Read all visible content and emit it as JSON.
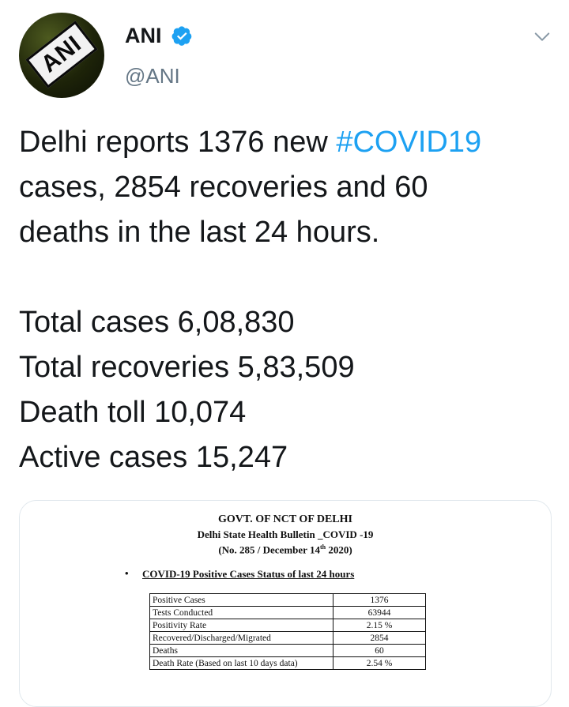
{
  "author": {
    "name": "ANI",
    "handle": "@ANI",
    "avatar_text": "ANI",
    "verified": true,
    "verified_icon": "verified-badge-icon",
    "verified_color": "#1da1f2"
  },
  "menu_icon": "chevron-down-icon",
  "tweet": {
    "line1_pre": "Delhi reports 1376 new ",
    "hashtag": "#COVID19",
    "line_rest": "cases, 2854 recoveries and 60\ndeaths in the last 24 hours.\n\nTotal cases 6,08,830\nTotal recoveries 5,83,509\nDeath toll 10,074\nActive cases 15,247"
  },
  "colors": {
    "link": "#1da1f2",
    "text": "#14171a",
    "secondary": "#657786"
  },
  "document": {
    "title1": "GOVT. OF NCT OF DELHI",
    "title2": "Delhi State Health Bulletin _COVID -19",
    "title3_pre": "(No. 285 / December 14",
    "title3_sup": "th",
    "title3_post": " 2020)",
    "bullet": "•",
    "subheading": "COVID-19 Positive Cases Status of last 24 hours",
    "table": [
      {
        "label": "Positive Cases",
        "value": "1376"
      },
      {
        "label": "Tests Conducted",
        "value": "63944"
      },
      {
        "label": "Positivity Rate",
        "value": "2.15 %"
      },
      {
        "label": "Recovered/Discharged/Migrated",
        "value": "2854"
      },
      {
        "label": "Deaths",
        "value": "60"
      },
      {
        "label": "Death Rate (Based on last 10 days data)",
        "value": "2.54 %"
      }
    ]
  }
}
